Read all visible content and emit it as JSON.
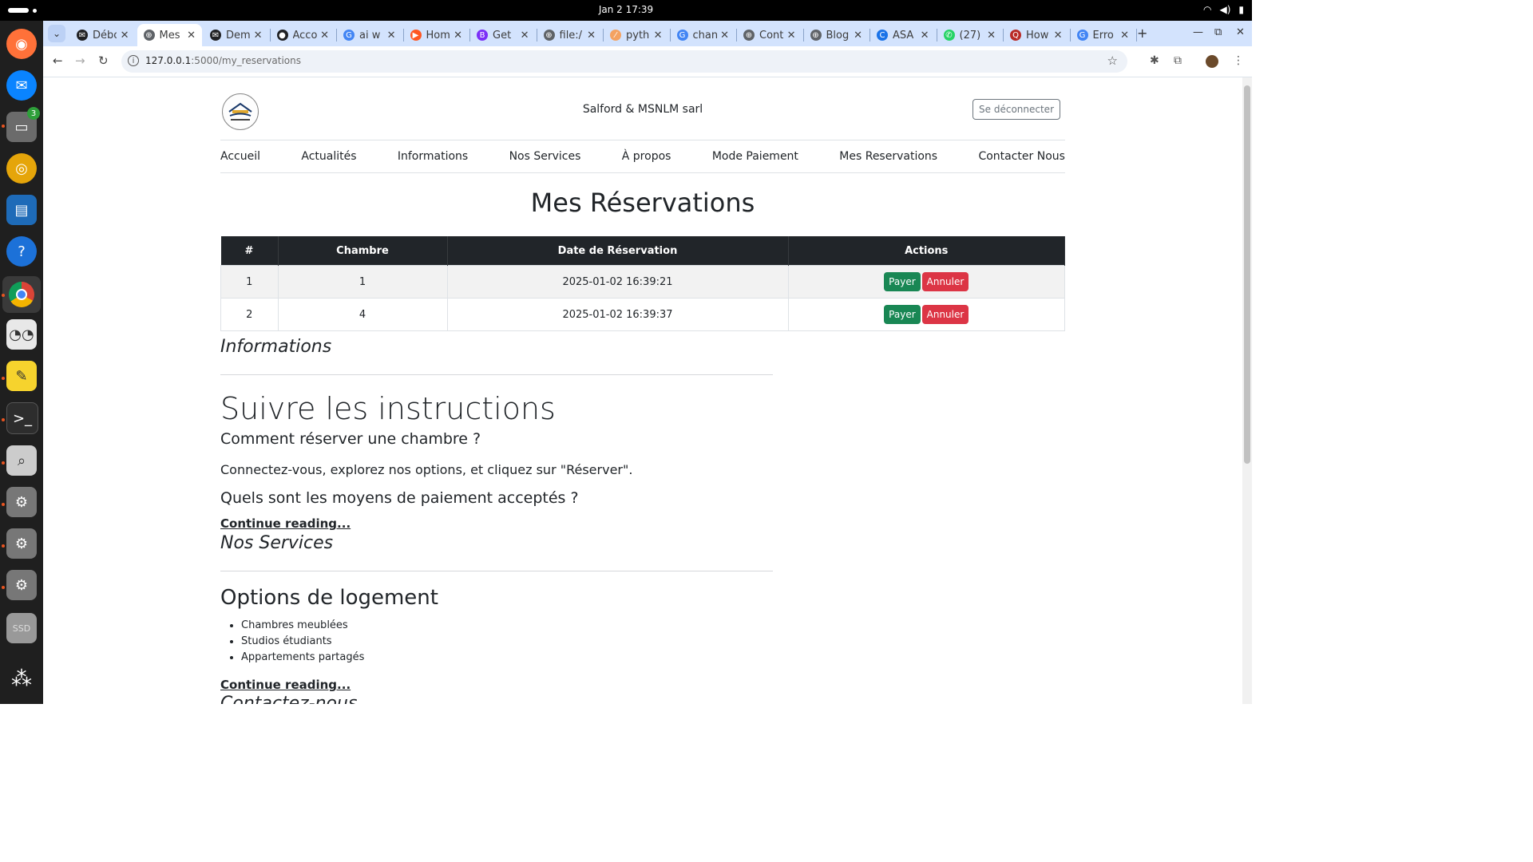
{
  "system": {
    "clock": "Jan 2  17:39",
    "files_badge": "3"
  },
  "browser": {
    "tabs": [
      {
        "label": "Débo",
        "color": "#202124",
        "glyph": "✉"
      },
      {
        "label": "Mes",
        "color": "#5f6368",
        "glyph": "⊕",
        "active": true
      },
      {
        "label": "Dem",
        "color": "#202124",
        "glyph": "✉"
      },
      {
        "label": "Acco",
        "color": "#202124",
        "glyph": "●"
      },
      {
        "label": "ai w",
        "color": "#4285f4",
        "glyph": "G"
      },
      {
        "label": "Hom",
        "color": "#ff5722",
        "glyph": "▶"
      },
      {
        "label": "Get",
        "color": "#7b2ff7",
        "glyph": "B"
      },
      {
        "label": "file:/",
        "color": "#5f6368",
        "glyph": "⊕"
      },
      {
        "label": "pyth",
        "color": "#f4a261",
        "glyph": "⁄"
      },
      {
        "label": "chan",
        "color": "#4285f4",
        "glyph": "G"
      },
      {
        "label": "Cont",
        "color": "#5f6368",
        "glyph": "⊕"
      },
      {
        "label": "Blog",
        "color": "#5f6368",
        "glyph": "⊕"
      },
      {
        "label": "ASA",
        "color": "#1a73e8",
        "glyph": "C"
      },
      {
        "label": "(27)",
        "color": "#25d366",
        "glyph": "✆"
      },
      {
        "label": "How",
        "color": "#b92b27",
        "glyph": "Q"
      },
      {
        "label": "Erro",
        "color": "#4285f4",
        "glyph": "G"
      }
    ],
    "url_host": "127.0.0.1",
    "url_path": ":5000/my_reservations"
  },
  "site": {
    "title": "Salford & MSNLM sarl",
    "logout": "Se déconnecter",
    "nav": [
      "Accueil",
      "Actualités",
      "Informations",
      "Nos Services",
      "À propos",
      "Mode Paiement",
      "Mes Reservations",
      "Contacter Nous"
    ]
  },
  "reservations": {
    "heading": "Mes Réservations",
    "columns": [
      "#",
      "Chambre",
      "Date de Réservation",
      "Actions"
    ],
    "rows": [
      {
        "num": "1",
        "room": "1",
        "date": "2025-01-02 16:39:21"
      },
      {
        "num": "2",
        "room": "4",
        "date": "2025-01-02 16:39:37"
      }
    ],
    "pay_label": "Payer",
    "cancel_label": "Annuler"
  },
  "informations": {
    "title": "Informations",
    "display": "Suivre les instructions",
    "q1": "Comment réserver une chambre ?",
    "a1": "Connectez-vous, explorez nos options, et cliquez sur \"Réserver\".",
    "q2": "Quels sont les moyens de paiement acceptés ?",
    "more": "Continue reading..."
  },
  "services": {
    "title": "Nos Services",
    "heading": "Options de logement",
    "items": [
      "Chambres meublées",
      "Studios étudiants",
      "Appartements partagés"
    ],
    "more": "Continue reading..."
  },
  "contact": {
    "title": "Contactez-nous"
  }
}
